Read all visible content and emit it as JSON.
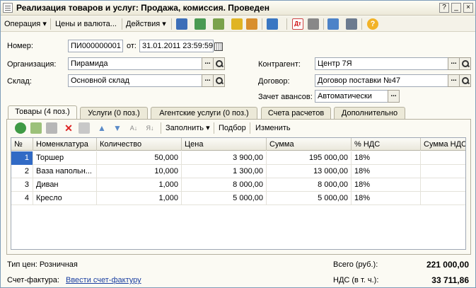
{
  "window": {
    "title": "Реализация товаров и услуг: Продажа, комиссия. Проведен",
    "help_btn": "?",
    "minimize_btn": "_",
    "close_btn": "×"
  },
  "toolbar": {
    "operation": "Операция",
    "prices": "Цены и валюта...",
    "actions": "Действия",
    "arrow": "▾"
  },
  "header": {
    "number_label": "Номер:",
    "number_value": "ПИ000000001",
    "from_label": "от:",
    "date_value": "31.01.2011 23:59:59",
    "org_label": "Организация:",
    "org_value": "Пирамида",
    "warehouse_label": "Склад:",
    "warehouse_value": "Основной склад",
    "contractor_label": "Контрагент:",
    "contractor_value": "Центр 7Я",
    "contract_label": "Договор:",
    "contract_value": "Договор поставки №47",
    "advance_label": "Зачет авансов:",
    "advance_value": "Автоматически",
    "dots": "..."
  },
  "tabs": [
    {
      "label": "Товары (4 поз.)"
    },
    {
      "label": "Услуги (0 поз.)"
    },
    {
      "label": "Агентские услуги (0 поз.)"
    },
    {
      "label": "Счета расчетов"
    },
    {
      "label": "Дополнительно"
    }
  ],
  "table_toolbar": {
    "fill": "Заполнить",
    "select": "Подбор",
    "change": "Изменить",
    "arrow": "▾"
  },
  "table": {
    "columns": [
      "№",
      "Номенклатура",
      "Количество",
      "Цена",
      "Сумма",
      "% НДС",
      "Сумма НДС"
    ],
    "rows": [
      [
        "1",
        "Торшер",
        "50,000",
        "3 900,00",
        "195 000,00",
        "18%"
      ],
      [
        "2",
        "Ваза напольн...",
        "10,000",
        "1 300,00",
        "13 000,00",
        "18%"
      ],
      [
        "3",
        "Диван",
        "1,000",
        "8 000,00",
        "8 000,00",
        "18%"
      ],
      [
        "4",
        "Кресло",
        "1,000",
        "5 000,00",
        "5 000,00",
        "18%"
      ]
    ]
  },
  "footer": {
    "price_type": "Тип цен: Розничная",
    "invoice_label": "Счет-фактура:",
    "invoice_link": "Ввести счет-фактуру",
    "total_label": "Всего (руб.):",
    "total_value": "221 000,00",
    "vat_label": "НДС (в т. ч.):",
    "vat_value": "33 711,86"
  },
  "colors": {
    "selected_row": "#316ac5",
    "link": "#1a3fa0"
  }
}
